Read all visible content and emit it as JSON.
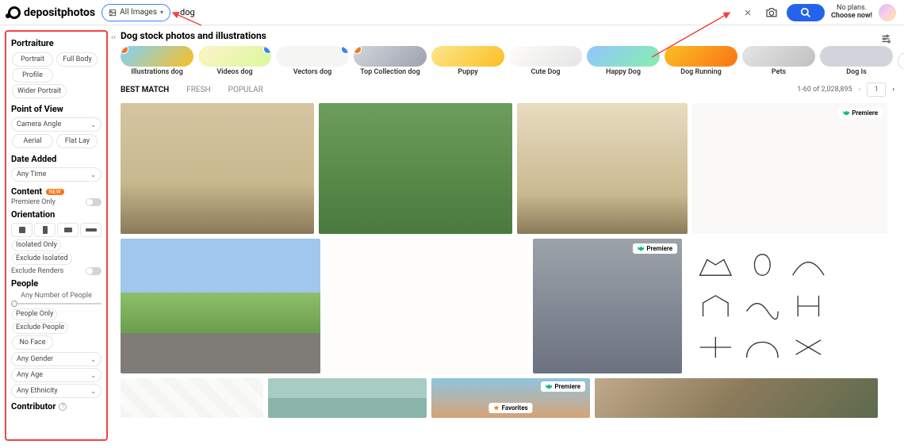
{
  "brand": "depositphotos",
  "header": {
    "category_label": "All Images",
    "search_value": "dog",
    "plans_line1": "No plans.",
    "plans_line2": "Choose now!"
  },
  "sidebar": {
    "portraiture": {
      "title": "Portraiture",
      "options": [
        "Portrait",
        "Full Body",
        "Profile",
        "Wider Portrait"
      ]
    },
    "pov": {
      "title": "Point of View",
      "select": "Camera Angle",
      "options": [
        "Aerial",
        "Flat Lay"
      ]
    },
    "date": {
      "title": "Date Added",
      "select": "Any Time"
    },
    "content": {
      "title": "Content",
      "badge": "NEW",
      "toggle_label": "Premiere Only"
    },
    "orientation": {
      "title": "Orientation",
      "isolated": "Isolated Only",
      "exclude": "Exclude Isolated",
      "renders": "Exclude Renders"
    },
    "people": {
      "title": "People",
      "slider_label": "Any Number of People",
      "only": "People Only",
      "exclude": "Exclude People",
      "noface": "No Face",
      "gender": "Any Gender",
      "age": "Any Age",
      "ethnicity": "Any Ethnicity"
    },
    "contributor": "Contributor"
  },
  "results": {
    "title": "Dog stock photos and illustrations",
    "categories": [
      {
        "label": "Illustrations dog",
        "badge": "#f97316"
      },
      {
        "label": "Videos dog",
        "badge": "#3b82f6"
      },
      {
        "label": "Vectors dog",
        "badge": "#3b82f6"
      },
      {
        "label": "Top Collection dog",
        "badge": "#f97316"
      },
      {
        "label": "Puppy"
      },
      {
        "label": "Cute Dog"
      },
      {
        "label": "Happy Dog"
      },
      {
        "label": "Dog Running"
      },
      {
        "label": "Pets"
      },
      {
        "label": "Dog Is"
      }
    ],
    "tabs": [
      "BEST MATCH",
      "FRESH",
      "POPULAR"
    ],
    "active_tab": "BEST MATCH",
    "count_text": "1-60 of 2,028,895",
    "page": "1",
    "premiere_label": "Premiere",
    "favorites_label": "Favorites"
  }
}
